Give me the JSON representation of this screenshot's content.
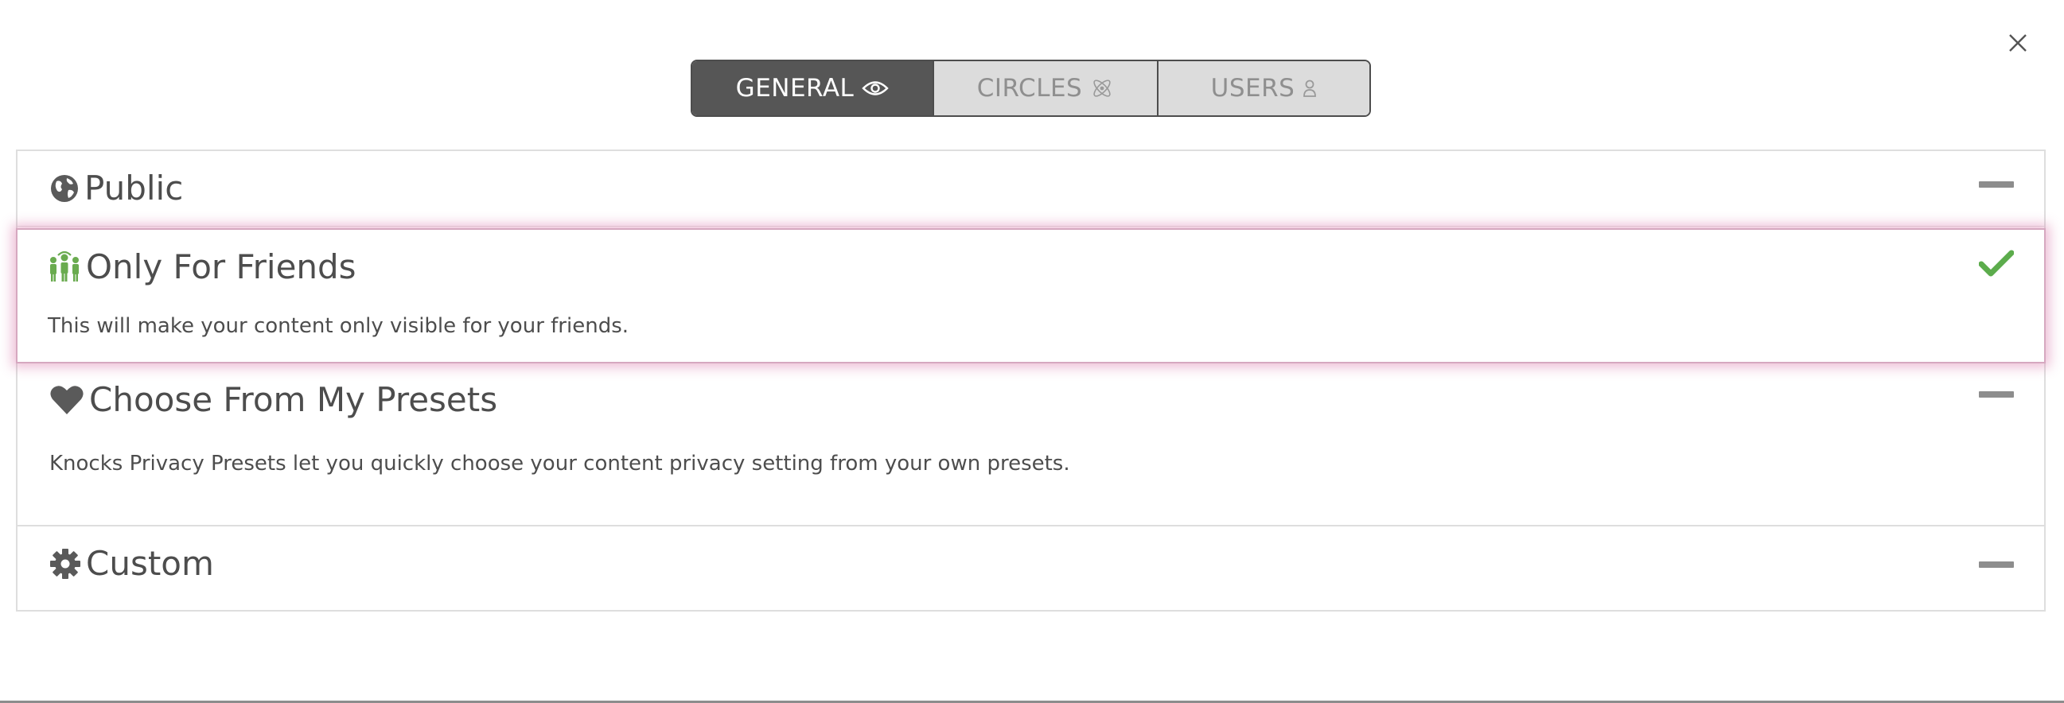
{
  "dialog": {
    "close_label": "×"
  },
  "tabs": [
    {
      "label": "GENERAL",
      "icon": "eye-icon",
      "active": true
    },
    {
      "label": "CIRCLES",
      "icon": "atom-icon",
      "active": false
    },
    {
      "label": "USERS",
      "icon": "user-icon",
      "active": false
    }
  ],
  "options": {
    "public": {
      "title": "Public",
      "icon": "globe-icon",
      "state": "collapsed"
    },
    "friends": {
      "title": "Only For Friends",
      "icon": "friends-icon",
      "description": "This will make your content only visible for your friends.",
      "state": "selected"
    },
    "presets": {
      "title": "Choose From My Presets",
      "icon": "heart-icon",
      "description": "Knocks Privacy Presets let you quickly choose your content privacy setting from your own presets.",
      "state": "collapsed"
    },
    "custom": {
      "title": "Custom",
      "icon": "gear-icon",
      "state": "collapsed"
    }
  },
  "colors": {
    "tab_active_bg": "#565656",
    "tab_inactive_bg": "#dcdcdc",
    "selected_highlight": "#d66ea5",
    "check_green": "#5cac4c",
    "friends_icon_green": "#6aab4f"
  }
}
